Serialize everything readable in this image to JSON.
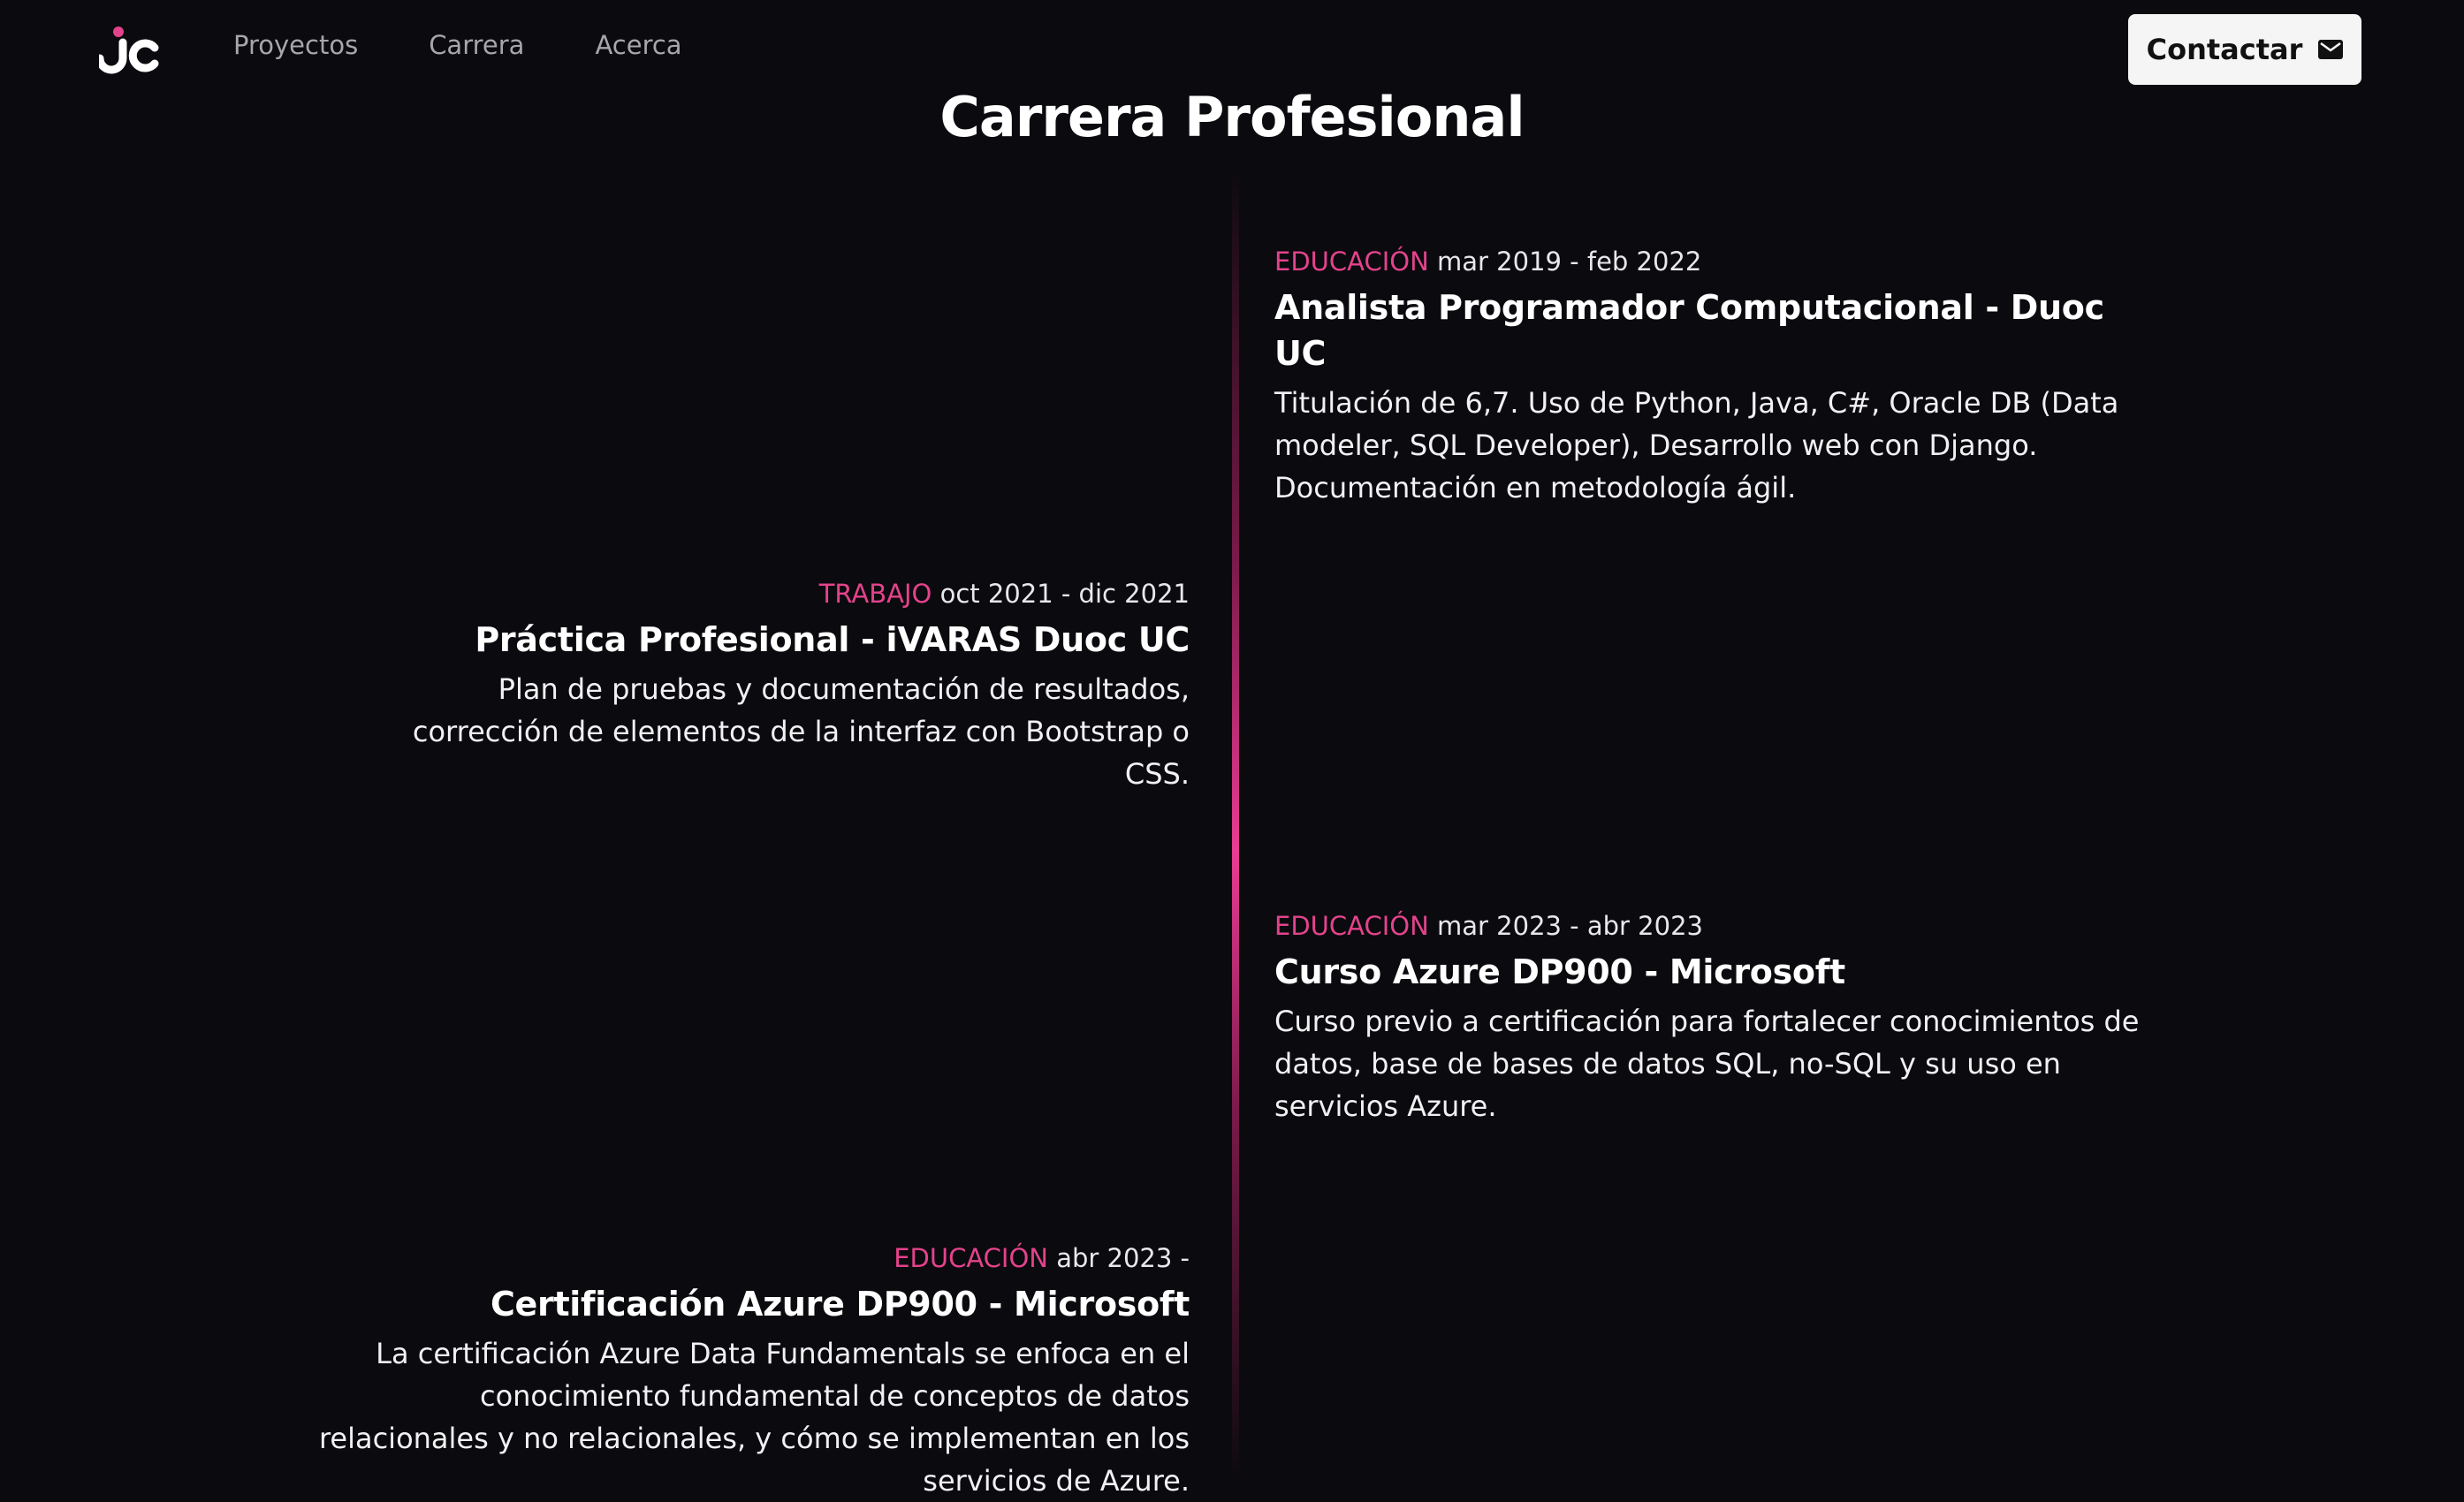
{
  "nav": {
    "logo_text": "JC",
    "links": [
      "Proyectos",
      "Carrera",
      "Acerca"
    ],
    "contact_label": "Contactar"
  },
  "colors": {
    "background": "#0b0a0e",
    "accent": "#e3438c",
    "button_bg": "#f5f5f5"
  },
  "page": {
    "title": "Carrera Profesional"
  },
  "timeline": [
    {
      "side": "right",
      "tag": "EDUCACIÓN",
      "date": "mar 2019 - feb 2022",
      "title": "Analista Programador Computacional - Duoc UC",
      "description": "Titulación de 6,7. Uso de Python, Java, C#, Oracle DB (Data modeler, SQL Developer), Desarrollo web con Django. Documentación en metodología ágil."
    },
    {
      "side": "left",
      "tag": "TRABAJO",
      "date": "oct 2021 - dic 2021",
      "title": "Práctica Profesional - iVARAS Duoc UC",
      "description": "Plan de pruebas y documentación de resultados, corrección de elementos de la interfaz con Bootstrap o CSS."
    },
    {
      "side": "right",
      "tag": "EDUCACIÓN",
      "date": "mar 2023 - abr 2023",
      "title": "Curso Azure DP900 - Microsoft",
      "description": "Curso previo a certificación para fortalecer conocimientos de datos, base de bases de datos SQL, no-SQL y su uso en servicios Azure."
    },
    {
      "side": "left",
      "tag": "EDUCACIÓN",
      "date": "abr 2023 -",
      "title": "Certificación Azure DP900 - Microsoft",
      "description": "La certificación Azure Data Fundamentals se enfoca en el conocimiento fundamental de conceptos de datos relacionales y no relacionales, y cómo se implementan en los servicios de Azure."
    }
  ]
}
